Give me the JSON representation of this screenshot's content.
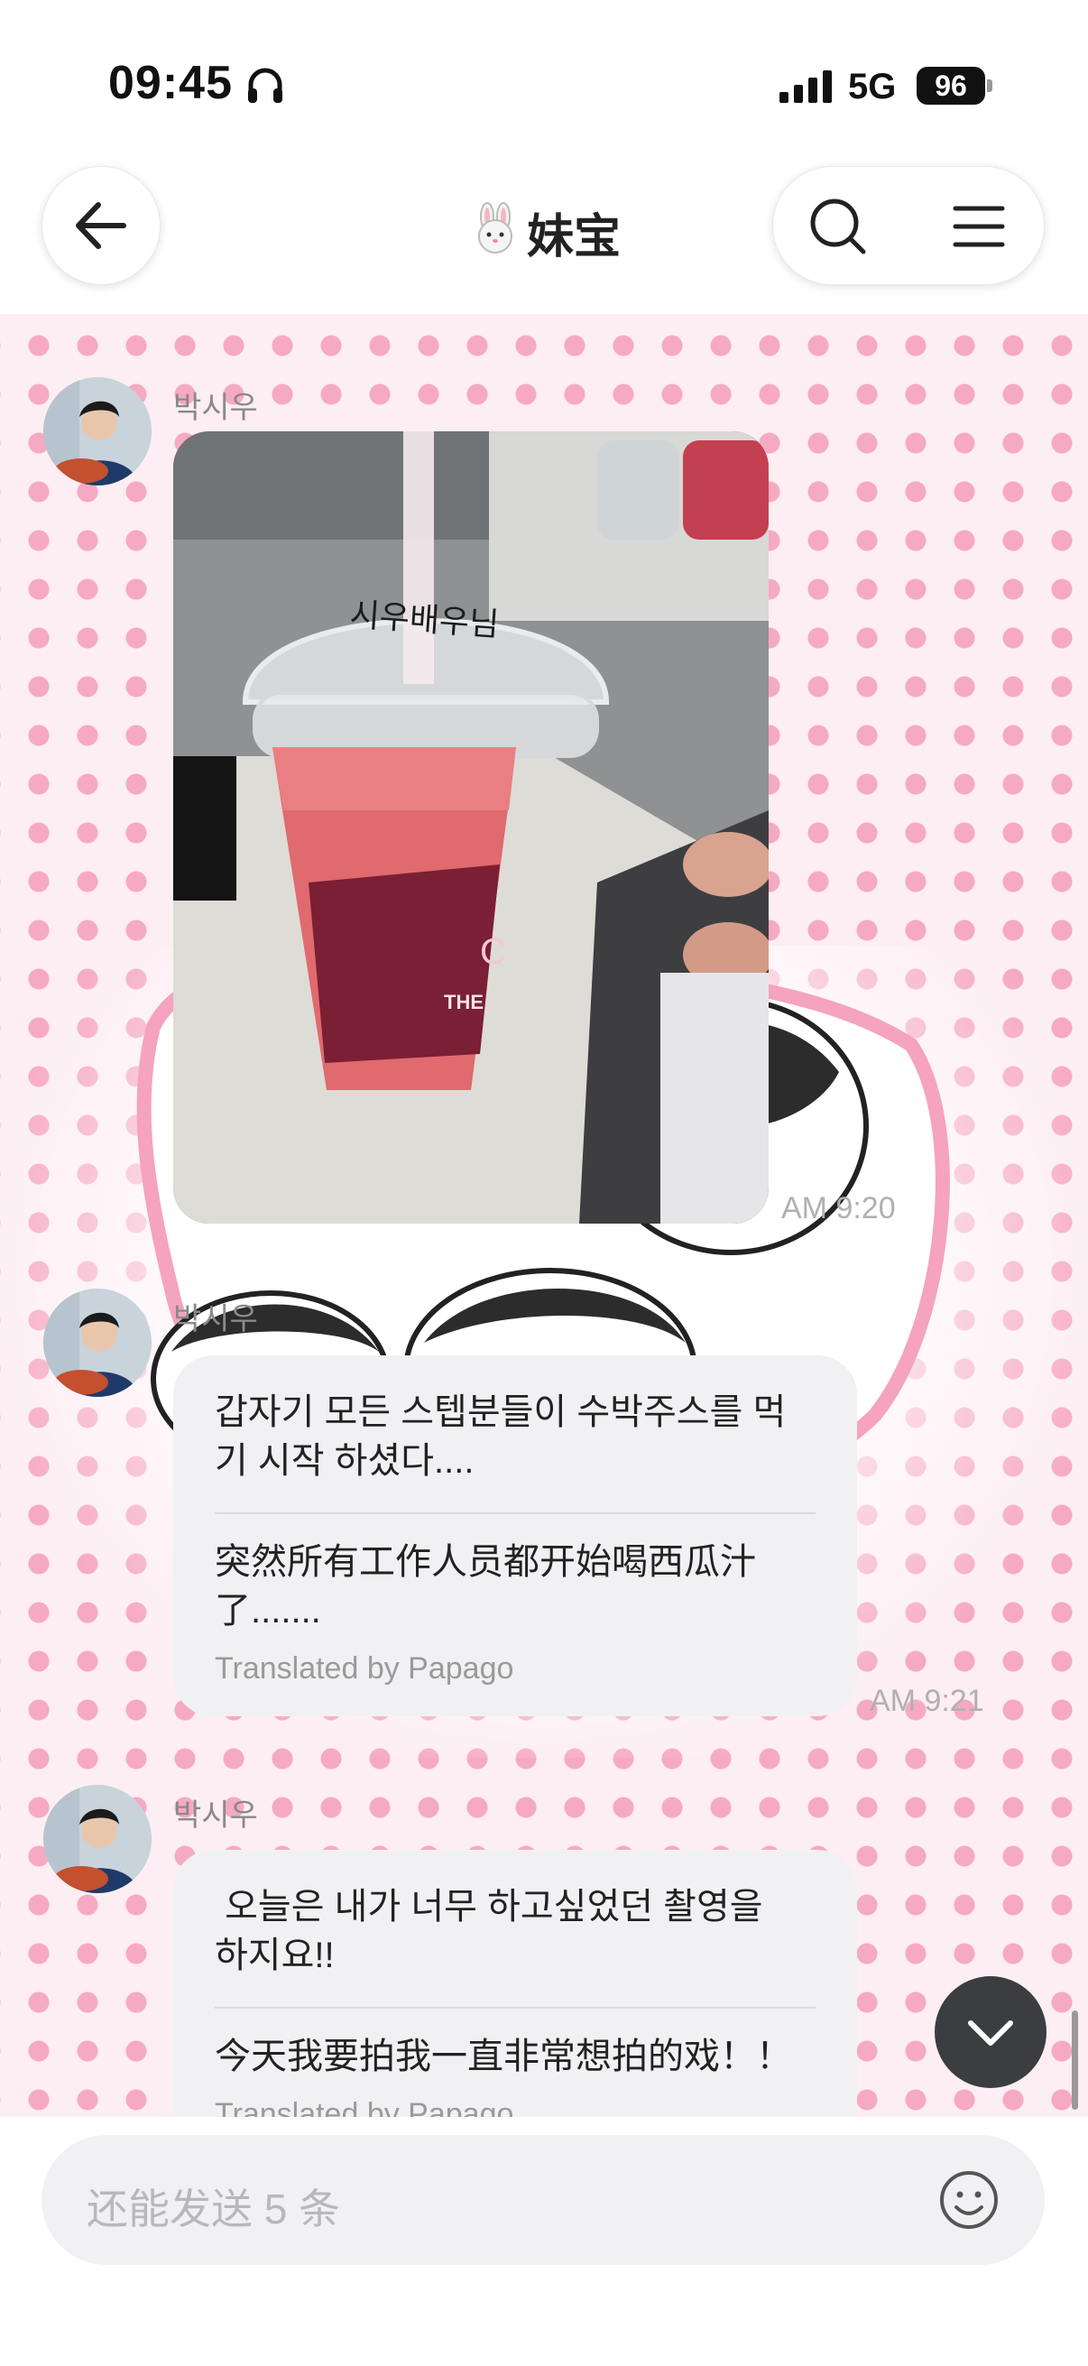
{
  "status_bar": {
    "time": "09:45",
    "network": "5G",
    "battery": "96"
  },
  "header": {
    "title": "妹宝",
    "title_icon": "rabbit-emoji"
  },
  "messages": [
    {
      "sender": "박시우",
      "type": "image",
      "image_text": "시우배우님",
      "cup_text": "THE",
      "time": "AM 9:20"
    },
    {
      "sender": "박시우",
      "type": "text",
      "ko": "갑자기 모든 스텝분들이 수박주스를 먹기 시작 하셨다....",
      "zh": "突然所有工作人员都开始喝西瓜汁了.......",
      "translated_by": "Translated by Papago",
      "time": "AM 9:21"
    },
    {
      "sender": "박시우",
      "type": "text",
      "ko": " 오늘은 내가 너무 하고싶었던 촬영을  하지요!!",
      "zh": "今天我要拍我一直非常想拍的戏！！",
      "translated_by": "Translated by Papago"
    }
  ],
  "input": {
    "placeholder": "还能发送 5 条"
  },
  "colors": {
    "background_dots": "#f6a9c2",
    "bubble": "#f1f1f3",
    "accent_pink": "#f5a3bf"
  }
}
